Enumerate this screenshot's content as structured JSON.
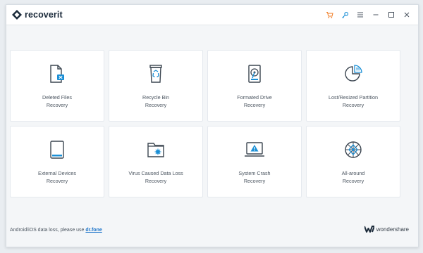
{
  "app": {
    "name": "recoverit"
  },
  "titlebar": {
    "icons": [
      "cart-icon",
      "key-icon",
      "menu-icon",
      "minimize-icon",
      "maximize-icon",
      "close-icon"
    ]
  },
  "cards": [
    {
      "line1": "Deleted Files",
      "line2": "Recovery",
      "icon": "deleted-file-icon"
    },
    {
      "line1": "Recycle Bin",
      "line2": "Recovery",
      "icon": "recycle-bin-icon"
    },
    {
      "line1": "Formated Drive",
      "line2": "Recovery",
      "icon": "hard-drive-icon"
    },
    {
      "line1": "Lost/Resized Partition",
      "line2": "Recovery",
      "icon": "partition-icon"
    },
    {
      "line1": "External Devices",
      "line2": "Recovery",
      "icon": "external-device-icon"
    },
    {
      "line1": "Virus Caused Data Loss",
      "line2": "Recovery",
      "icon": "virus-folder-icon"
    },
    {
      "line1": "System Crash",
      "line2": "Recovery",
      "icon": "system-crash-icon"
    },
    {
      "line1": "All-around",
      "line2": "Recovery",
      "icon": "all-around-icon"
    }
  ],
  "footer": {
    "text": "Android/iOS data loss, please use",
    "link": "dr.fone",
    "brand": "wondershare"
  },
  "colors": {
    "accent": "#1a73c9",
    "orange": "#f07b22",
    "icon_stroke": "#3c4651"
  }
}
